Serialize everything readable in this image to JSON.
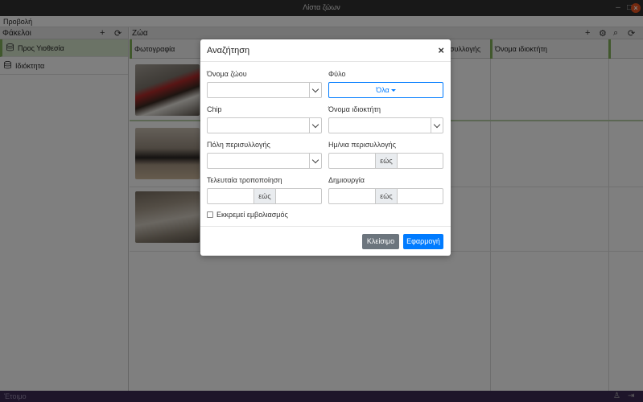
{
  "window": {
    "title": "Λίστα ζώων"
  },
  "menu": {
    "items": [
      "Προβολή"
    ]
  },
  "sidebar": {
    "title": "Φάκελοι",
    "items": [
      {
        "label": "Προς Υιοθεσία",
        "active": true
      },
      {
        "label": "Ιδιόκτητα",
        "active": false
      }
    ]
  },
  "main": {
    "title": "Ζώα",
    "columns": [
      "Φωτογραφία",
      "συλλογής",
      "Όνομα ιδιοκτήτη"
    ]
  },
  "modal": {
    "title": "Αναζήτηση",
    "close_glyph": "×",
    "fields": {
      "animal_name": {
        "label": "Όνομα ζώου",
        "value": ""
      },
      "sex": {
        "label": "Φύλο",
        "value": "Όλα"
      },
      "chip": {
        "label": "Chip",
        "value": ""
      },
      "owner_name": {
        "label": "Όνομα ιδιοκτήτη",
        "value": ""
      },
      "collection_city": {
        "label": "Πόλη περισυλλογής",
        "value": ""
      },
      "collection_date": {
        "label": "Ημ/νια περισυλλογής",
        "sep": "εώς"
      },
      "last_modified": {
        "label": "Τελευταία τροποποίηση",
        "sep": "εώς"
      },
      "created": {
        "label": "Δημιουργία",
        "sep": "εώς"
      },
      "pending_vaccination": {
        "label": "Εκκρεμεί εμβολιασμός",
        "checked": false
      }
    },
    "buttons": {
      "close": "Κλείσιμο",
      "apply": "Εφαρμογή"
    }
  },
  "status": {
    "text": "Έτοιμο"
  },
  "colors": {
    "accent": "#83b05b",
    "primary": "#007bff",
    "secondary": "#6c757d",
    "statusbar": "#3c2a55",
    "close": "#e95420"
  }
}
